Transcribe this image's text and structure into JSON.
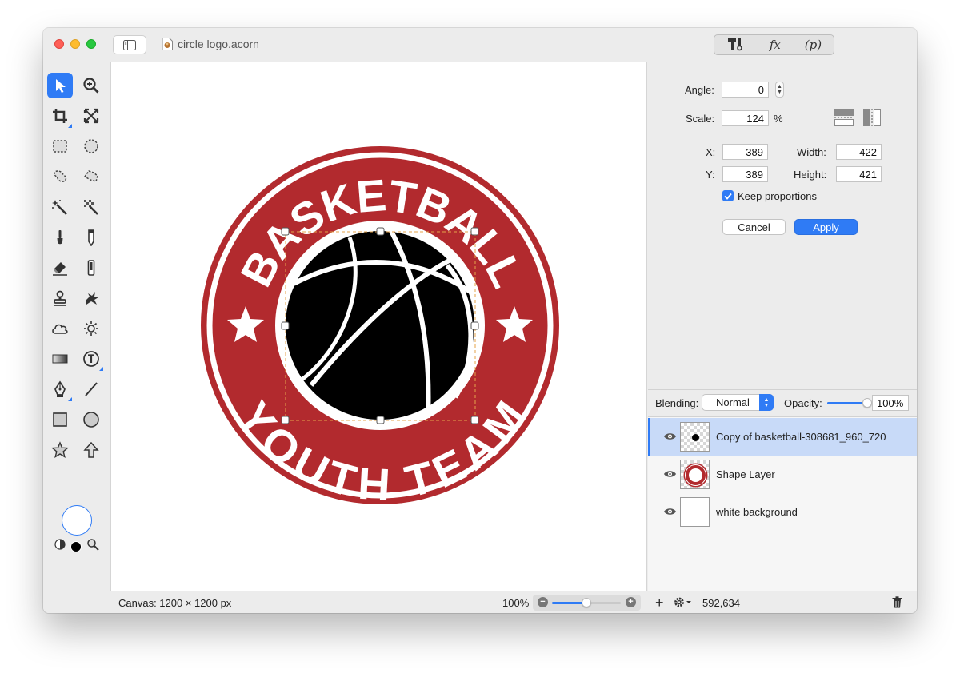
{
  "window": {
    "document_title": "circle logo.acorn"
  },
  "top_tools": {
    "fx_label": "fx",
    "p_label": "(p)"
  },
  "artwork": {
    "top_text": "BASKETBALL",
    "bottom_text": "YOUTH TEAM",
    "ring_color": "#b22a2e"
  },
  "transform": {
    "angle_label": "Angle:",
    "angle_value": "0",
    "scale_label": "Scale:",
    "scale_value": "124",
    "scale_unit": "%",
    "x_label": "X:",
    "x_value": "389",
    "y_label": "Y:",
    "y_value": "389",
    "width_label": "Width:",
    "width_value": "422",
    "height_label": "Height:",
    "height_value": "421",
    "keep_proportions_label": "Keep proportions",
    "keep_proportions_checked": true,
    "cancel_label": "Cancel",
    "apply_label": "Apply"
  },
  "layers": {
    "blending_label": "Blending:",
    "blending_value": "Normal",
    "opacity_label": "Opacity:",
    "opacity_value": "100%",
    "opacity_fraction": 1.0,
    "items": [
      {
        "name": "Copy of basketball-308681_960_720",
        "visible": true,
        "selected": true
      },
      {
        "name": "Shape Layer",
        "visible": true,
        "selected": false
      },
      {
        "name": "white background",
        "visible": true,
        "selected": false
      }
    ]
  },
  "status": {
    "canvas_size": "Canvas: 1200 × 1200 px",
    "zoom_value": "100%",
    "zoom_fraction": 0.5,
    "coordinates": "592,634"
  },
  "colors": {
    "accent": "#2f7bf5",
    "selected_row": "#c8daf8"
  }
}
